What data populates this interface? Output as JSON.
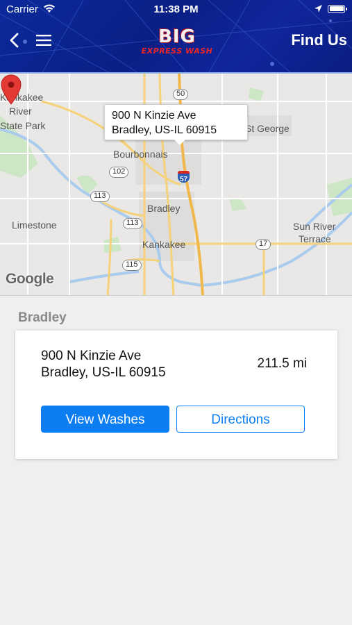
{
  "status_bar": {
    "carrier": "Carrier",
    "time": "11:38 PM",
    "battery_level": 1.0
  },
  "header": {
    "back_icon": "chevron-left-icon",
    "menu_icon": "hamburger-menu-icon",
    "logo_text": "BIG",
    "logo_subtext": "EXPRESS WASH",
    "title": "Find Us",
    "background_color": "#0b2a9a"
  },
  "map": {
    "callout": {
      "line1": "900 N Kinzie Ave",
      "line2": "Bradley, US-IL  60915"
    },
    "places": {
      "kankakee_river_line1": "Kankakee",
      "kankakee_river_line2": "River",
      "kankakee_river_line3": "State Park",
      "st_george": "St George",
      "bourbonnais": "Bourbonnais",
      "bradley": "Bradley",
      "limestone": "Limestone",
      "kankakee": "Kankakee",
      "sun_river_line1": "Sun River",
      "sun_river_line2": "Terrace"
    },
    "highways": {
      "h50": "50",
      "h102": "102",
      "h113a": "113",
      "h113b": "113",
      "h115": "115",
      "h17": "17",
      "i57": "57"
    },
    "attribution": "Google",
    "pin_color": "#e53935"
  },
  "location": {
    "section": "Bradley",
    "address_line1": "900 N Kinzie Ave",
    "address_line2": "Bradley, US-IL  60915",
    "distance": "211.5 mi",
    "view_washes_label": "View Washes",
    "directions_label": "Directions",
    "accent_color": "#0d7ef2"
  }
}
